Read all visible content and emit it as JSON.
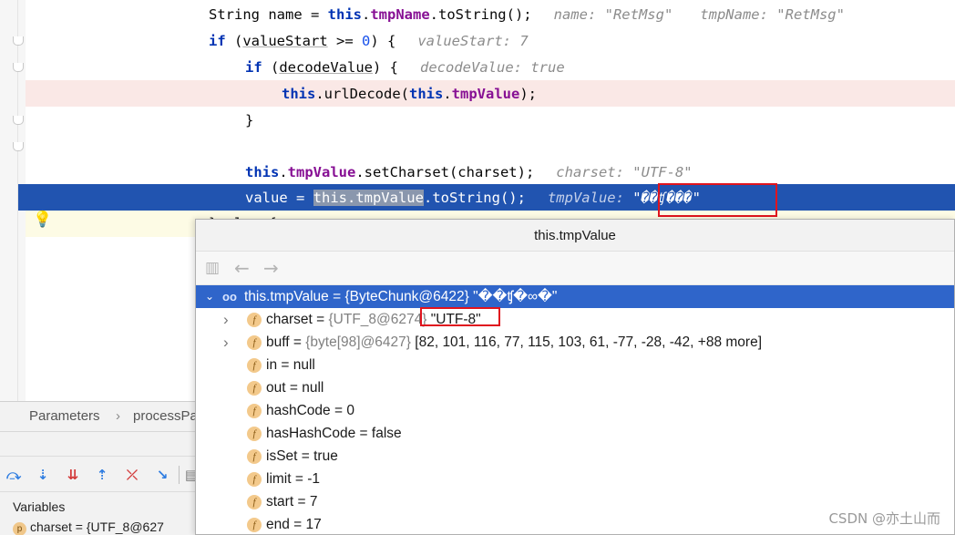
{
  "code": {
    "line1": {
      "a": "String name = ",
      "kw": "this",
      "dot": ".",
      "field": "tmpName",
      "b": ".toString();",
      "hint1": "name: ",
      "hint1v": "\"RetMsg\"",
      "hint2": "tmpName: ",
      "hint2v": "\"RetMsg\""
    },
    "line2": {
      "kw": "if",
      "a": " (",
      "var": "valueStart",
      "b": " >= ",
      "num": "0",
      "c": ") {",
      "hint": "valueStart: ",
      "hintv": "7"
    },
    "line3": {
      "kw": "if",
      "a": " (",
      "var": "decodeValue",
      "b": ") {",
      "hint": "decodeValue: ",
      "hintv": "true"
    },
    "line4": {
      "kw": "this",
      "a": ".urlDecode(",
      "kw2": "this",
      "dot": ".",
      "field": "tmpValue",
      "b": ");"
    },
    "line5": {
      "a": "}"
    },
    "line6": {
      "kw": "this",
      "dot": ".",
      "field": "tmpValue",
      "a": ".setCharset(charset);",
      "hint": "charset: ",
      "hintv": "\"UTF-8\""
    },
    "line7": {
      "a": "value = ",
      "sel": "this.tmpValue",
      "b": ".toString();",
      "hint": "tmpValue: ",
      "hintv": "\"��ʧ���\""
    },
    "line8": {
      "a": "} else {"
    }
  },
  "left_panel": {
    "params_tab": "Parameters",
    "frame_sep": "›",
    "frame_name": "processPa",
    "toolbar_icons": [
      "step-over-icon",
      "step-into-icon",
      "force-step-into-icon",
      "step-out-icon",
      "drop-frame-icon",
      "run-to-cursor-icon",
      "evaluate-icon"
    ],
    "variables_label": "Variables",
    "variables_row": "charset = {UTF_8@627",
    "variables_badge": "p"
  },
  "popup": {
    "title": "this.tmpValue",
    "root": {
      "name": "this.tmpValue = ",
      "meta": "{ByteChunk@6422} ",
      "value": "\"��ʧ�∞�\""
    },
    "fields": [
      {
        "expand": true,
        "name": "charset = ",
        "meta": "{UTF_8@6274} ",
        "value": "\"UTF-8\""
      },
      {
        "expand": true,
        "name": "buff = ",
        "meta": "{byte[98]@6427} ",
        "value": "[82, 101, 116, 77, 115, 103, 61, -77, -28, -42, +88 more]"
      },
      {
        "expand": false,
        "name": "in = ",
        "meta": "",
        "value": "null"
      },
      {
        "expand": false,
        "name": "out = ",
        "meta": "",
        "value": "null"
      },
      {
        "expand": false,
        "name": "hashCode = ",
        "meta": "",
        "value": "0"
      },
      {
        "expand": false,
        "name": "hasHashCode = ",
        "meta": "",
        "value": "false"
      },
      {
        "expand": false,
        "name": "isSet = ",
        "meta": "",
        "value": "true"
      },
      {
        "expand": false,
        "name": "limit = ",
        "meta": "",
        "value": "-1"
      },
      {
        "expand": false,
        "name": "start = ",
        "meta": "",
        "value": "7"
      },
      {
        "expand": false,
        "name": "end = ",
        "meta": "",
        "value": "17"
      }
    ]
  },
  "colors": {
    "exec_line": "#2154b0",
    "breakpoint_line": "#fae8e6",
    "accent_red": "#e0141e",
    "selected_row": "#2f65ca"
  },
  "watermark": "CSDN @亦土山而"
}
